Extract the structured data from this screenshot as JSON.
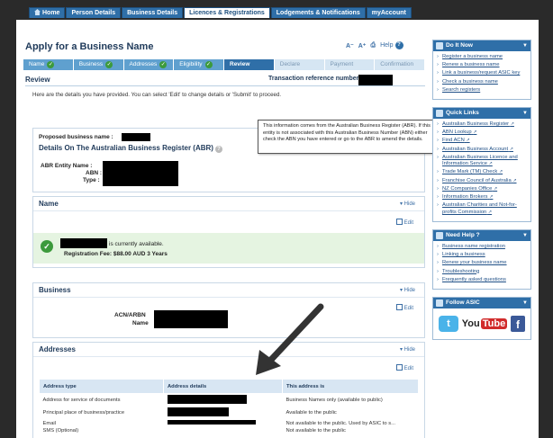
{
  "topnav": [
    {
      "label": "Home",
      "active": false
    },
    {
      "label": "Person Details",
      "active": false
    },
    {
      "label": "Business Details",
      "active": false
    },
    {
      "label": "Licences & Registrations",
      "active": true
    },
    {
      "label": "Lodgements & Notifications",
      "active": false
    },
    {
      "label": "myAccount",
      "active": false
    }
  ],
  "page": {
    "title": "Apply for a Business Name",
    "help_label": "Help"
  },
  "steps": [
    {
      "label": "Name",
      "state": "done"
    },
    {
      "label": "Business",
      "state": "done"
    },
    {
      "label": "Addresses",
      "state": "done"
    },
    {
      "label": "Eligibility",
      "state": "done"
    },
    {
      "label": "Review",
      "state": "current"
    },
    {
      "label": "Declare",
      "state": "todo"
    },
    {
      "label": "Payment",
      "state": "todo"
    },
    {
      "label": "Confirmation",
      "state": "todo"
    }
  ],
  "review": {
    "heading": "Review",
    "trn_label": "Transaction reference number:",
    "intro": "Here are the details you have provided. You can select 'Edit' to change details or 'Submit' to proceed."
  },
  "proposed": {
    "label": "Proposed business name :",
    "abr_title": "Details On The Australian Business Register (ABR)",
    "abr_entity_label": "ABR Entity Name :",
    "abn_label": "ABN :",
    "type_label": "Type :"
  },
  "tooltip": "This information comes from the Australian Business Register (ABR). If this entity is not associated with this Australian Business Number (ABN) either check the ABN you have entered or go to the ABR to amend the details.",
  "name_section": {
    "heading": "Name",
    "hide": "Hide",
    "edit": "Edit",
    "available_text": "is currently available.",
    "fee_text": "Registration Fee: $88.00 AUD 3 Years"
  },
  "business_section": {
    "heading": "Business",
    "hide": "Hide",
    "edit": "Edit",
    "acn_label": "ACN/ARBN",
    "name_label": "Name"
  },
  "addresses_section": {
    "heading": "Addresses",
    "hide": "Hide",
    "edit": "Edit",
    "columns": [
      "Address type",
      "Address details",
      "This address is"
    ],
    "rows": [
      {
        "type": "Address for service of documents",
        "is": "Business Names only (available to public)"
      },
      {
        "type": "Principal place of business/practice",
        "is": "Available to the public"
      },
      {
        "type": "Email",
        "is": "Not available to the public. Used by ASIC to s..."
      },
      {
        "type": "SMS (Optional)",
        "is": "Not available to the public"
      }
    ]
  },
  "sidebar": {
    "do_it_now": {
      "title": "Do It Now",
      "items": [
        "Register a business name",
        "Renew a business name",
        "Link a business/request ASIC key",
        "Check a business name",
        "Search registers"
      ]
    },
    "quick_links": {
      "title": "Quick Links",
      "items": [
        "Australian Business Register",
        "ABN Lookup",
        "Find ACN",
        "Australian Business Account",
        "Australian Business Licence and Information Service",
        "Trade Mark (TM) Check",
        "Franchise Council of Australia",
        "NZ Companies Office",
        "Information Brokers",
        "Australian Charities and Not-for-profits Commission"
      ]
    },
    "need_help": {
      "title": "Need Help ?",
      "items": [
        "Business name registration",
        "Linking a business",
        "Renew your business name",
        "Troubleshooting",
        "Frequently asked questions"
      ]
    },
    "follow": {
      "title": "Follow ASIC",
      "youtube_you": "You",
      "youtube_tube": "Tube"
    }
  },
  "colors": {
    "primary": "#2f6fa8",
    "success": "#3c9a3c",
    "band": "#e5f4e1"
  }
}
